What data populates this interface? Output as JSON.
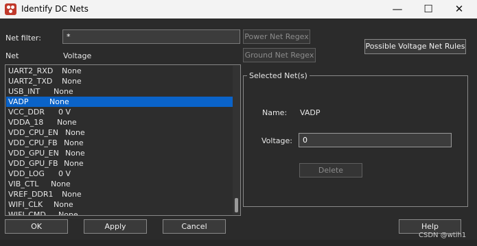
{
  "window": {
    "title": "Identify DC Nets",
    "controls": {
      "minimize": "—",
      "maximize": "☐",
      "close": "✕"
    }
  },
  "filter": {
    "label": "Net filter:",
    "value": "*"
  },
  "buttons": {
    "power_regex": "Power Net Regex",
    "ground_regex": "Ground Net Regex",
    "possible_rules": "Possible Voltage Net Rules",
    "ok": "OK",
    "apply": "Apply",
    "cancel": "Cancel",
    "help": "Help",
    "delete": "Delete"
  },
  "list": {
    "headers": {
      "net": "Net",
      "voltage": "Voltage"
    },
    "rows": [
      {
        "net": "UART2_RXD",
        "voltage": "None"
      },
      {
        "net": "UART2_TXD",
        "voltage": "None"
      },
      {
        "net": "USB_INT",
        "voltage": "None"
      },
      {
        "net": "VADP",
        "voltage": "None",
        "selected": true
      },
      {
        "net": "VCC_DDR",
        "voltage": "0 V"
      },
      {
        "net": "VDDA_18",
        "voltage": "None"
      },
      {
        "net": "VDD_CPU_EN",
        "voltage": "None"
      },
      {
        "net": "VDD_CPU_FB",
        "voltage": "None"
      },
      {
        "net": "VDD_GPU_EN",
        "voltage": "None"
      },
      {
        "net": "VDD_GPU_FB",
        "voltage": "None"
      },
      {
        "net": "VDD_LOG",
        "voltage": "0 V"
      },
      {
        "net": "VIB_CTL",
        "voltage": "None"
      },
      {
        "net": "VREF_DDR1",
        "voltage": "None"
      },
      {
        "net": "WIFI_CLK",
        "voltage": "None"
      },
      {
        "net": "WIFI_CMD",
        "voltage": "None"
      }
    ]
  },
  "selected": {
    "title": "Selected Net(s)",
    "name_label": "Name:",
    "name_value": "VADP",
    "voltage_label": "Voltage:",
    "voltage_value": "0"
  },
  "watermark": "CSDN @wtih1"
}
